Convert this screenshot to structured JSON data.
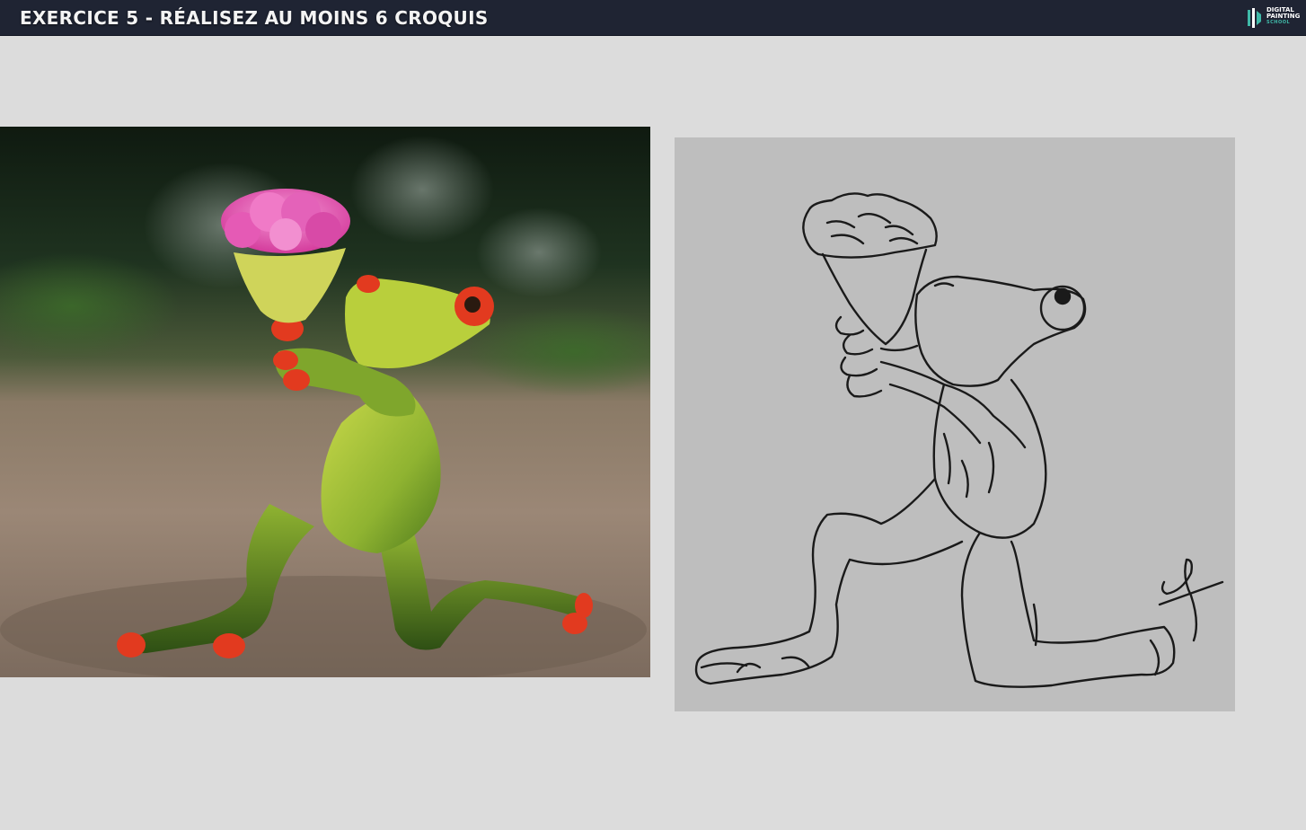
{
  "header": {
    "title": "EXERCICE 5 - RÉALISEZ AU MOINS 6 CROQUIS",
    "background": "#1f2433",
    "title_color": "#f4f4f4"
  },
  "logo": {
    "line1": "DIGITAL",
    "line2": "PAINTING",
    "line3": "SCHOOL",
    "accent": "#3fb9a8"
  },
  "content": {
    "reference_image": "frog-figurine-with-rose-bouquet-photo",
    "sketch_image": "frog-line-drawing-sketch",
    "page_background": "#dcdcdc",
    "sketch_background": "#bebebe"
  }
}
